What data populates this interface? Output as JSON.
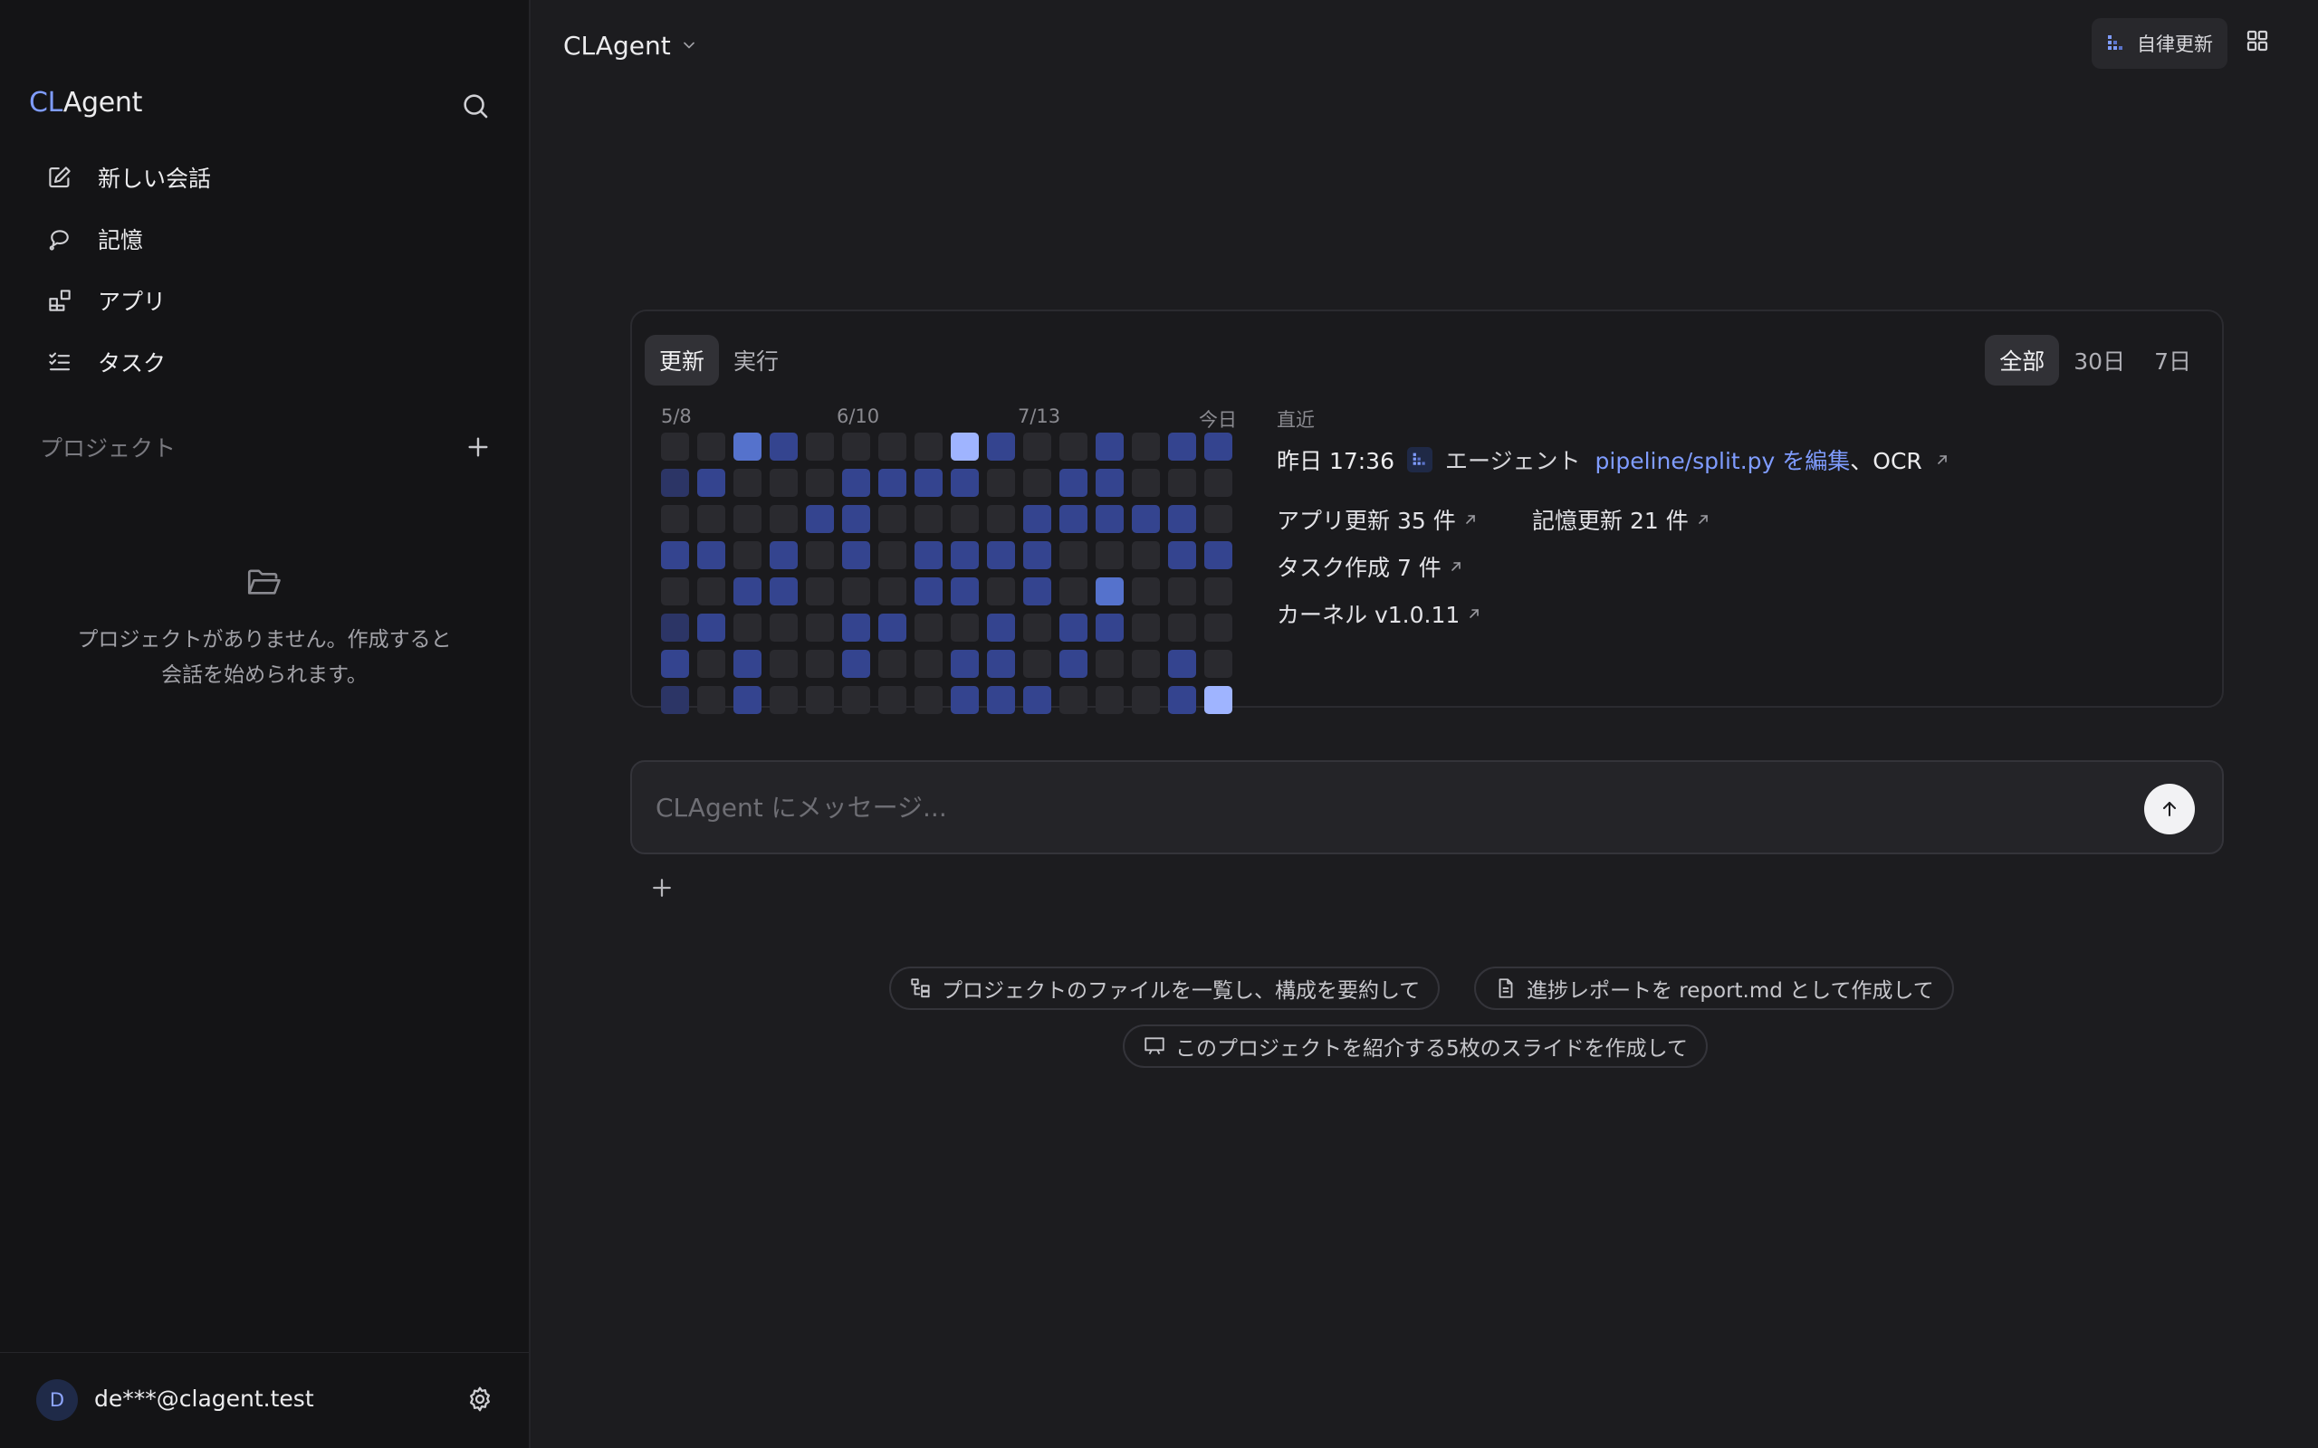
{
  "sidebar": {
    "brand_prefix": "CL",
    "brand_suffix": "Agent",
    "nav": [
      {
        "label": "新しい会話",
        "icon": "edit-icon"
      },
      {
        "label": "記憶",
        "icon": "memory-icon"
      },
      {
        "label": "アプリ",
        "icon": "apps-icon"
      },
      {
        "label": "タスク",
        "icon": "tasks-icon"
      }
    ],
    "projects_title": "プロジェクト",
    "empty_text_line1": "プロジェクトがありません。作成すると",
    "empty_text_line2": "会話を始められます。",
    "user_initial": "D",
    "user_email": "de***@clagent.test"
  },
  "header": {
    "model_name": "CLAgent",
    "auto_update_label": "自律更新"
  },
  "activity": {
    "tabs": [
      "更新",
      "実行"
    ],
    "active_tab": "更新",
    "ranges": [
      "全部",
      "30日",
      "7日"
    ],
    "active_range": "全部",
    "date_labels": [
      "5/8",
      "6/10",
      "7/13",
      "今日"
    ],
    "heatmap_levels": [
      [
        0,
        1,
        0,
        2,
        0,
        1,
        2,
        1
      ],
      [
        0,
        2,
        0,
        2,
        0,
        2,
        0,
        0
      ],
      [
        3,
        0,
        0,
        0,
        2,
        0,
        2,
        2
      ],
      [
        2,
        0,
        0,
        2,
        2,
        0,
        0,
        0
      ],
      [
        0,
        0,
        2,
        0,
        0,
        0,
        0,
        0
      ],
      [
        0,
        2,
        2,
        2,
        0,
        2,
        2,
        0
      ],
      [
        0,
        2,
        0,
        0,
        0,
        2,
        0,
        0
      ],
      [
        0,
        2,
        0,
        2,
        2,
        0,
        0,
        0
      ],
      [
        4,
        2,
        0,
        2,
        2,
        0,
        2,
        2
      ],
      [
        2,
        0,
        0,
        2,
        0,
        2,
        2,
        2
      ],
      [
        0,
        0,
        2,
        2,
        2,
        0,
        0,
        2
      ],
      [
        0,
        2,
        2,
        0,
        0,
        2,
        2,
        0
      ],
      [
        2,
        2,
        2,
        0,
        3,
        2,
        0,
        0
      ],
      [
        0,
        0,
        2,
        0,
        0,
        0,
        0,
        0
      ],
      [
        2,
        0,
        2,
        2,
        0,
        0,
        2,
        2
      ],
      [
        2,
        0,
        0,
        2,
        0,
        0,
        0,
        4
      ]
    ],
    "recent_title": "直近",
    "recent_time": "昨日 17:36",
    "recent_agent": "エージェント",
    "recent_link": "pipeline/split.py を編集",
    "recent_tail": "、OCR",
    "stats": {
      "app_updates": "アプリ更新 35 件",
      "memory_updates": "記憶更新 21 件",
      "tasks_created": "タスク作成 7 件",
      "kernel": "カーネル v1.0.11"
    }
  },
  "composer": {
    "placeholder": "CLAgent にメッセージ..."
  },
  "suggestions": [
    {
      "label": "プロジェクトのファイルを一覧し、構成を要約して",
      "icon": "file-tree-icon"
    },
    {
      "label": "進捗レポートを report.md として作成して",
      "icon": "document-icon"
    },
    {
      "label": "このプロジェクトを紹介する5枚のスライドを作成して",
      "icon": "presentation-icon"
    }
  ],
  "colors": {
    "accent": "#7f9cff",
    "heat_levels": [
      "#2a2a2f",
      "#2c3566",
      "#34448f",
      "#5572cc",
      "#9fb4ff"
    ]
  }
}
